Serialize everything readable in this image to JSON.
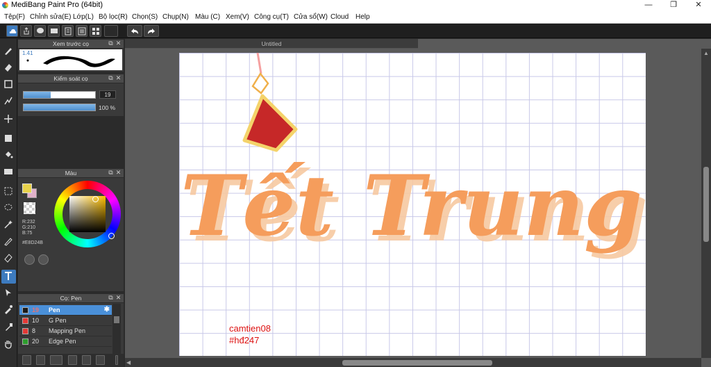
{
  "window": {
    "title": "MediBang Paint Pro (64bit)",
    "minimize": "—",
    "restore": "❐",
    "close": "✕"
  },
  "menu": [
    "Tệp(F)",
    "Chỉnh sửa(E)",
    "Lớp(L)",
    "Bộ lọc(R)",
    "Chọn(S)",
    "Chụp(N)",
    "Màu (C)",
    "Xem(V)",
    "Công cụ(T)",
    "Cửa sổ(W)",
    "Cloud",
    "Help"
  ],
  "toolbar": {
    "icons": [
      "cloud-icon",
      "share-icon",
      "comment-icon",
      "message-icon",
      "page-icon",
      "list-icon",
      "grid-icon"
    ],
    "undo_icon": "undo-icon",
    "redo_icon": "redo-icon"
  },
  "tools": [
    "brush-icon",
    "eraser-icon",
    "rectangle-icon",
    "line-icon",
    "move-icon",
    "fill-rect-icon",
    "bucket-icon",
    "gradient-icon",
    "select-rect-icon",
    "lasso-icon",
    "magic-wand-icon",
    "select-pen-icon",
    "select-eraser-icon",
    "text-icon",
    "operation-icon",
    "eyedropper-icon",
    "dropper-icon",
    "hand-icon"
  ],
  "brush_preview": {
    "title": "Xem trước cọ",
    "size_label": "1.41"
  },
  "brush_control": {
    "title": "Kiểm soát cọ",
    "size_value": "19",
    "size_fraction": 0.38,
    "opacity_value": "100 %",
    "opacity_fraction": 1.0
  },
  "color": {
    "title": "Màu",
    "primary": "#E8D24B",
    "r_label": "R:232",
    "g_label": "G:210",
    "b_label": "B:75",
    "hex_label": "#E8D24B"
  },
  "brush_list": {
    "title": "Cọ: Pen",
    "items": [
      {
        "size": "19",
        "name": "Pen",
        "color": "#1a1a1a",
        "selected": true
      },
      {
        "size": "10",
        "name": "G Pen",
        "color": "#e53935",
        "selected": false
      },
      {
        "size": "8",
        "name": "Mapping Pen",
        "color": "#e53935",
        "selected": false
      },
      {
        "size": "20",
        "name": "Edge Pen",
        "color": "#2e9e2e",
        "selected": false
      }
    ]
  },
  "document": {
    "tab_title": "Untitled",
    "signature_line1": "camtien08",
    "signature_line2": "#hđ247",
    "artwork_text": "Tết Trung Thu"
  }
}
